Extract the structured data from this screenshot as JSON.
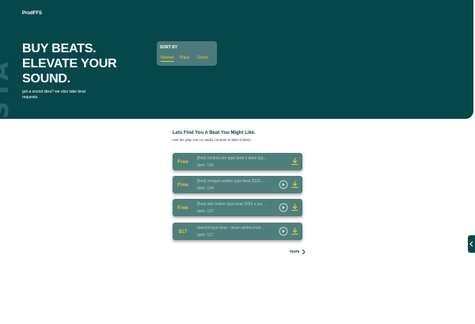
{
  "brand": "ProdFFS",
  "hero": {
    "title": "BUY BEATS. ELEVATE YOUR SOUND.",
    "subtitle": "got a sound idea? we also take beat requests.",
    "watermark": "SYA"
  },
  "sort": {
    "label": "SORT BY",
    "options": [
      "Newest",
      "Plays",
      "Genre"
    ],
    "active": "Newest"
  },
  "intro": {
    "title": "Lets Find You A Beat You Might Like.",
    "subtitle": "use the play icon or audio controls to take a listen."
  },
  "beats": [
    {
      "price": "Free",
      "title": "[free] central cee type beat x dave typ...",
      "bpm": "bpm: 135",
      "has_play": false
    },
    {
      "price": "Free",
      "title": "[free] morgan wallen type beat 2023 ...",
      "bpm": "bpm: 134",
      "has_play": true
    },
    {
      "price": "Free",
      "title": "[free] dan tollver type beat 2023 x jus...",
      "bpm": "bpm: 137",
      "has_play": true
    },
    {
      "price": "$17",
      "title": "doechii type beat - ntuan ahima insti...",
      "bpm": "bpm: 117",
      "has_play": true
    }
  ],
  "more_label": "more",
  "colors": {
    "primary": "#06474b",
    "card": "#4f7f7c",
    "accent": "#e8c43a"
  },
  "icons": {
    "play": "play-circle-icon",
    "download": "download-icon",
    "more": "chevron-right-icon",
    "side": "chevron-left-icon"
  }
}
